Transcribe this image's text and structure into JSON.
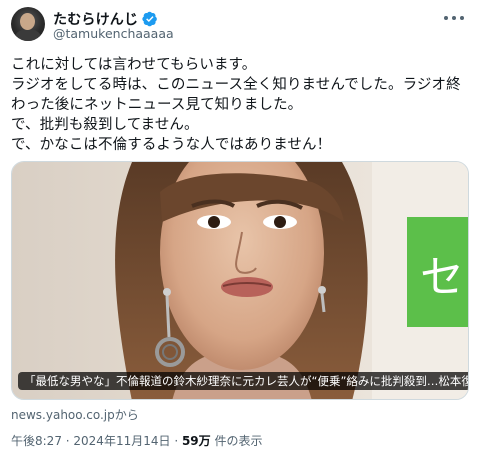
{
  "author": {
    "display_name": "たむらけんじ",
    "handle": "@tamukenchaaaaa",
    "avatar_icon": "avatar-photo",
    "verified_icon": "verified-badge-icon",
    "verified_color": "#1d9bf0"
  },
  "tweet": {
    "text": "これに対しては言わせてもらいます。\nラジオをしてる時は、このニュース全く知りませんでした。ラジオ終わった後にネットニュース見て知りました。\nで、批判も殺到してません。\nで、かなこは不倫するような人ではありません！"
  },
  "link_card": {
    "title": "「最低な男やな」不倫報道の鈴木紗理奈に元カレ芸人が“便乗”絡みに批判殺到…松本復帰...",
    "source": "news.yahoo.co.jpから"
  },
  "meta": {
    "time": "午後8:27",
    "date": "2024年11月14日",
    "views_count": "59万",
    "views_label": " 件の表示",
    "separator": " · "
  }
}
